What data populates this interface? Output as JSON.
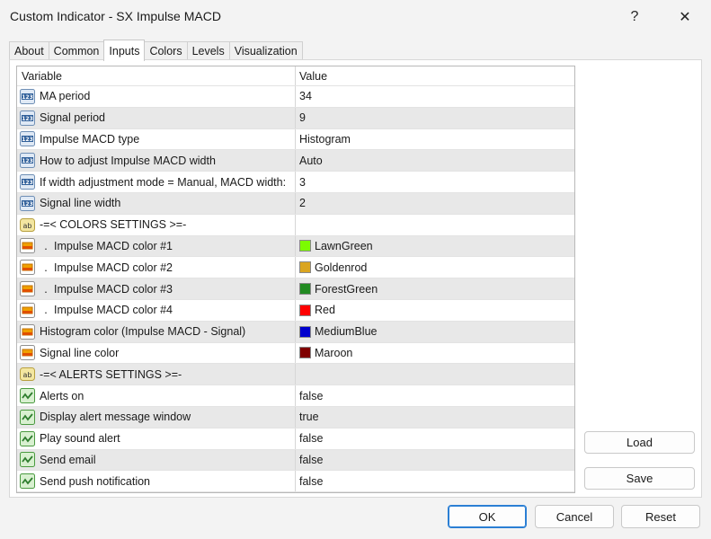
{
  "window": {
    "title": "Custom Indicator - SX Impulse MACD",
    "help_label": "?",
    "close_label": "✕"
  },
  "tabs": [
    {
      "label": "About"
    },
    {
      "label": "Common"
    },
    {
      "label": "Inputs",
      "active": true
    },
    {
      "label": "Colors"
    },
    {
      "label": "Levels"
    },
    {
      "label": "Visualization"
    }
  ],
  "grid": {
    "headers": {
      "variable": "Variable",
      "value": "Value"
    },
    "rows": [
      {
        "icon": "number-icon",
        "variable": "MA period",
        "value": "34"
      },
      {
        "icon": "number-icon",
        "variable": "Signal period",
        "value": "9"
      },
      {
        "icon": "number-icon",
        "variable": "Impulse MACD type",
        "value": "Histogram"
      },
      {
        "icon": "number-icon",
        "variable": "How to adjust Impulse MACD width",
        "value": "Auto"
      },
      {
        "icon": "number-icon",
        "variable": "If width adjustment mode = Manual, MACD width:",
        "value": "3"
      },
      {
        "icon": "number-icon",
        "variable": "Signal line width",
        "value": "2"
      },
      {
        "icon": "text-icon",
        "variable": "-=< COLORS SETTINGS >=-",
        "value": ""
      },
      {
        "icon": "color-icon",
        "prefix": ".",
        "variable": "Impulse MACD color #1",
        "value": "LawnGreen",
        "color": "#7cfc00"
      },
      {
        "icon": "color-icon",
        "prefix": ".",
        "variable": "Impulse MACD color #2",
        "value": "Goldenrod",
        "color": "#daa520"
      },
      {
        "icon": "color-icon",
        "prefix": ".",
        "variable": "Impulse MACD color #3",
        "value": "ForestGreen",
        "color": "#228b22"
      },
      {
        "icon": "color-icon",
        "prefix": ".",
        "variable": "Impulse MACD color #4",
        "value": "Red",
        "color": "#ff0000"
      },
      {
        "icon": "color-icon",
        "variable": "Histogram color (Impulse MACD - Signal)",
        "value": "MediumBlue",
        "color": "#0000cd"
      },
      {
        "icon": "color-icon",
        "variable": "Signal line color",
        "value": "Maroon",
        "color": "#800000"
      },
      {
        "icon": "text-icon",
        "variable": "-=< ALERTS SETTINGS >=-",
        "value": ""
      },
      {
        "icon": "bool-icon",
        "variable": "Alerts on",
        "value": "false"
      },
      {
        "icon": "bool-icon",
        "variable": "Display alert message window",
        "value": "true"
      },
      {
        "icon": "bool-icon",
        "variable": "Play sound alert",
        "value": "false"
      },
      {
        "icon": "bool-icon",
        "variable": "Send email",
        "value": "false"
      },
      {
        "icon": "bool-icon",
        "variable": "Send push notification",
        "value": "false"
      }
    ]
  },
  "buttons": {
    "load": "Load",
    "save": "Save",
    "ok": "OK",
    "cancel": "Cancel",
    "reset": "Reset"
  },
  "icon_glyphs": {
    "number": "123",
    "text": "ab"
  }
}
